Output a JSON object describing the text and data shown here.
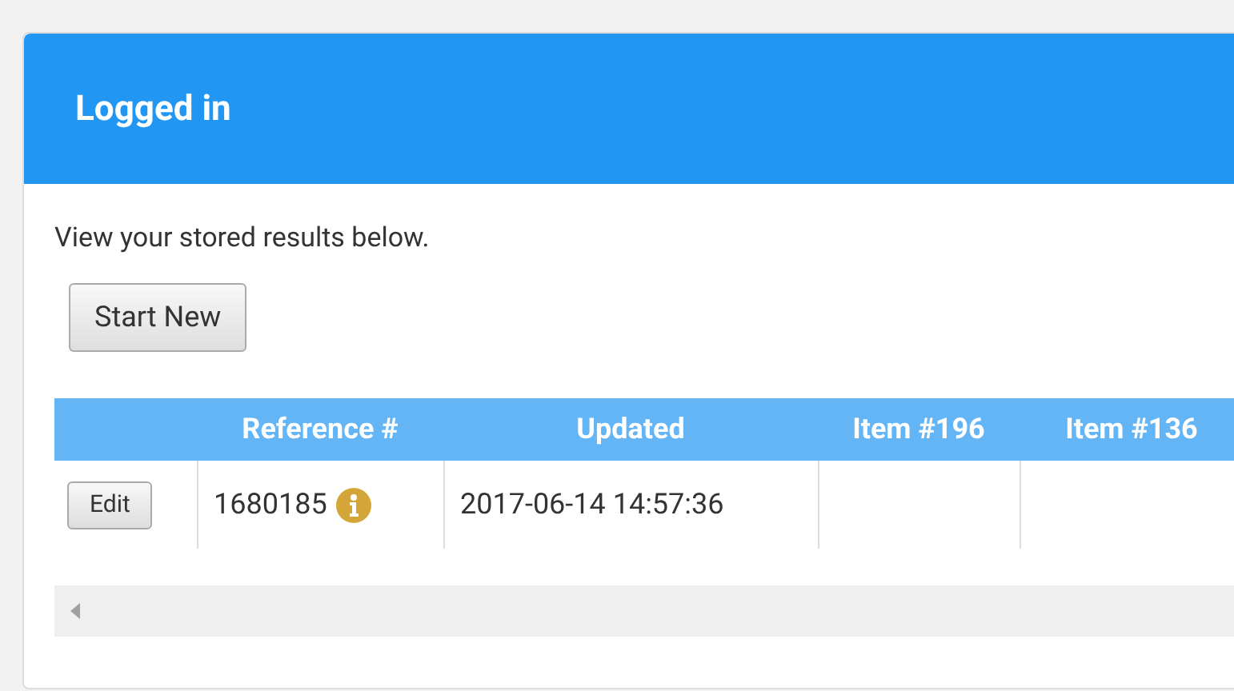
{
  "panel": {
    "title": "Logged in"
  },
  "intro": "View your stored results below.",
  "start_button": "Start New",
  "table": {
    "columns": [
      "Reference #",
      "Updated",
      "Item #196",
      "Item #136"
    ],
    "rows": [
      {
        "action": "Edit",
        "reference": "1680185",
        "updated": "2017-06-14 14:57:36"
      }
    ]
  }
}
